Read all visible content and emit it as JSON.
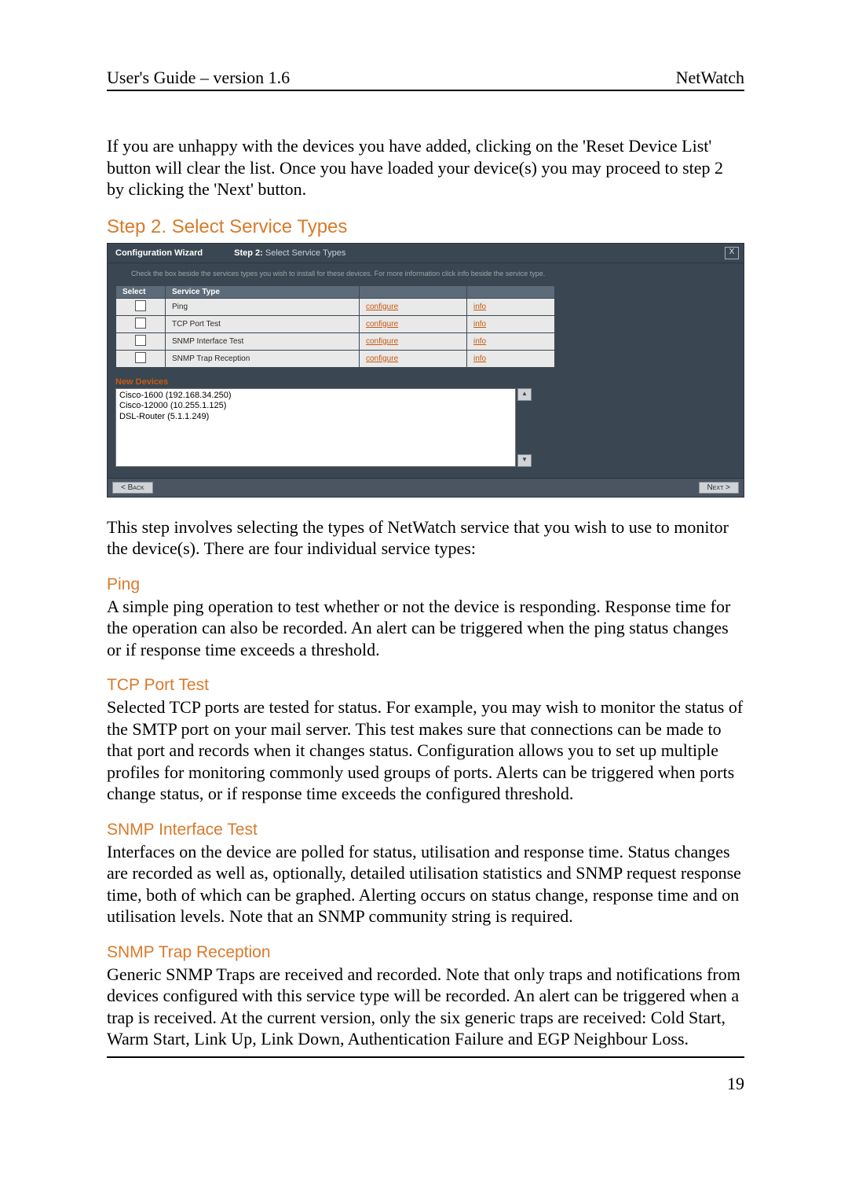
{
  "header": {
    "left": "User's Guide – version 1.6",
    "right": "NetWatch"
  },
  "intro_paragraph": "If you are unhappy with the devices you have added, clicking on the 'Reset Device List' button will clear the list. Once you have loaded your device(s) you may proceed to step 2 by clicking the 'Next' button.",
  "step2_heading": "Step 2. Select Service Types",
  "wizard": {
    "title": "Configuration Wizard",
    "step_label_bold": "Step 2:",
    "step_label_rest": " Select Service Types",
    "close_glyph": "X",
    "note": "Check the box beside the services types you wish to install for these devices. For more information click info beside the service type.",
    "columns": {
      "select": "Select",
      "service_type": "Service Type"
    },
    "rows": [
      {
        "name": "Ping",
        "configure": "configure",
        "info": "info"
      },
      {
        "name": "TCP Port Test",
        "configure": "configure",
        "info": "info"
      },
      {
        "name": "SNMP Interface Test",
        "configure": "configure",
        "info": "info"
      },
      {
        "name": "SNMP Trap Reception",
        "configure": "configure",
        "info": "info"
      }
    ],
    "new_devices_label": "New Devices",
    "devices": [
      "Cisco-1600 (192.168.34.250)",
      "Cisco-12000 (10.255.1.125)",
      "DSL-Router (5.1.1.249)"
    ],
    "back_label": "< Back",
    "next_label": "Next >"
  },
  "after_wizard_paragraph": "This step involves selecting the types of NetWatch service that you wish to use to monitor the device(s). There are four individual service types:",
  "sections": {
    "ping": {
      "title": "Ping",
      "body": "A simple ping operation to test whether or not the device is responding. Response time for the operation can also be recorded. An alert can be triggered when the ping status changes or if response time exceeds a threshold."
    },
    "tcp": {
      "title": "TCP Port Test",
      "body": "Selected TCP ports are tested for status. For example, you may wish to monitor the status of the SMTP port on your mail server. This test makes sure that connections can be made to that port and records when it changes status. Configuration allows you to set up multiple profiles for monitoring commonly used groups of ports. Alerts can be triggered when ports change status, or if response time exceeds the configured threshold."
    },
    "snmp_if": {
      "title": "SNMP Interface Test",
      "body": "Interfaces on the device are polled for status, utilisation and response time. Status changes are recorded as well as, optionally, detailed utilisation statistics and SNMP request response time, both of which can be graphed. Alerting occurs on status change, response time and on utilisation levels. Note that an SNMP community string is required."
    },
    "snmp_trap": {
      "title": "SNMP Trap Reception",
      "body": "Generic SNMP Traps are received and recorded. Note that only traps and notifications from devices configured with this service type will be recorded. An alert can be triggered when a trap is received. At the current version, only the six generic traps are received: Cold Start, Warm Start, Link Up, Link Down, Authentication Failure and EGP Neighbour Loss."
    }
  },
  "page_number": "19"
}
